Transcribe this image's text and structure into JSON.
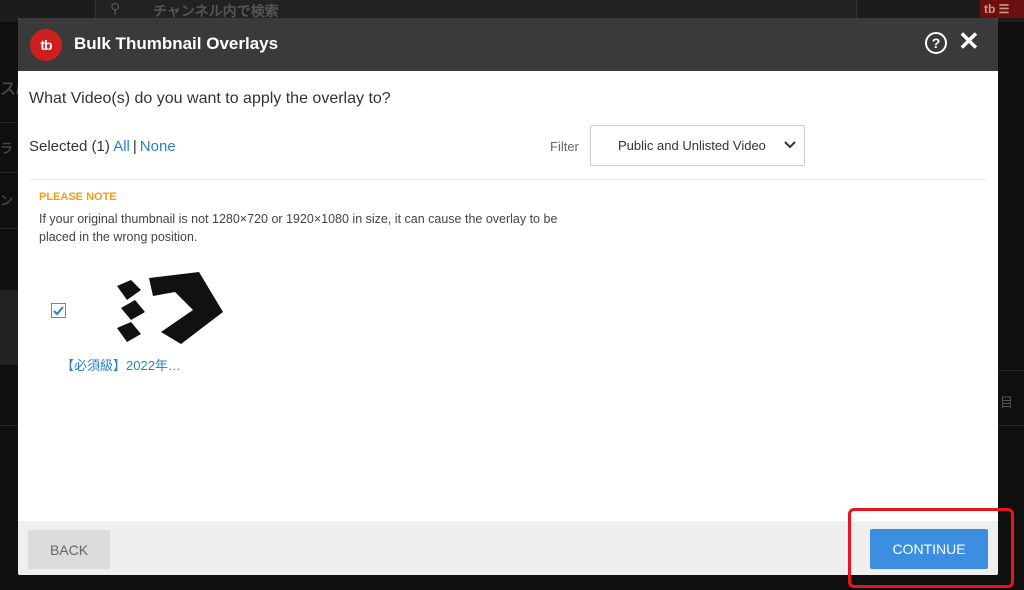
{
  "background": {
    "search_placeholder": "チャンネル内で検索",
    "tb_badge": "tb ☰",
    "left_fragments": [
      "ス/",
      "ラ",
      "ン"
    ],
    "right_fragment": "目"
  },
  "modal": {
    "logo_text": "tb",
    "title": "Bulk Thumbnail Overlays",
    "question": "What Video(s) do you want to apply the overlay to?",
    "selected_label": "Selected (1)",
    "all_link": "All",
    "separator": "|",
    "none_link": "None",
    "filter_label": "Filter",
    "filter_value": "Public and Unlisted Videos",
    "note_title": "PLEASE NOTE",
    "note_text": "If your original thumbnail is not 1280×720 or 1920×1080 in size, it can cause the overlay to be placed in the wrong position.",
    "videos": [
      {
        "title": "【必須級】2022年…",
        "checked": true
      }
    ],
    "back_label": "BACK",
    "continue_label": "CONTINUE"
  },
  "colors": {
    "header_bg": "#3a3a3a",
    "logo_red": "#cc1f1f",
    "link_blue": "#2a7fd0",
    "note_orange": "#f39c12",
    "continue_blue": "#3b8ee0",
    "highlight_red": "#e8141e"
  },
  "icons": {
    "help": "help-circle-icon",
    "close": "close-icon",
    "dropdown": "chevron-down-icon",
    "checkbox": "check-icon"
  }
}
